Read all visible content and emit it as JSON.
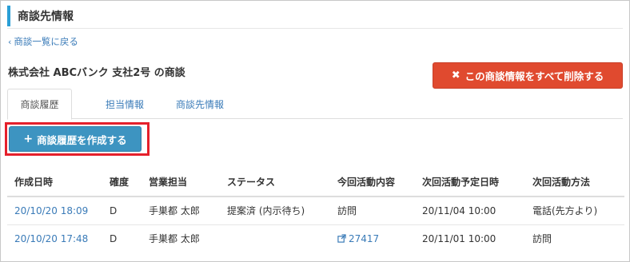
{
  "header": {
    "title": "商談先情報"
  },
  "nav": {
    "back_label": "商談一覧に戻る",
    "back_icon": "chevron-left-icon"
  },
  "deal": {
    "title": "株式会社 ABCバンク 支社2号 の商談"
  },
  "actions": {
    "delete_label": "この商談情報をすべて削除する",
    "create_label": "商談履歴を作成する"
  },
  "colors": {
    "accent_bar": "#2a9fd6",
    "delete": "#e04a2f",
    "create": "#3d94c1",
    "link": "#3a7bb8",
    "highlight": "#e5202b"
  },
  "tabs": [
    {
      "label": "商談履歴",
      "active": true
    },
    {
      "label": "担当情報",
      "active": false
    },
    {
      "label": "商談先情報",
      "active": false
    }
  ],
  "table": {
    "columns": [
      "作成日時",
      "確度",
      "営業担当",
      "ステータス",
      "今回活動内容",
      "次回活動予定日時",
      "次回活動方法"
    ],
    "rows": [
      {
        "created": "20/10/20 18:09",
        "probability": "D",
        "sales_rep": "手巣都 太郎",
        "status": "提案済 (内示待ち)",
        "activity": "訪問",
        "next_date": "20/11/04 10:00",
        "next_method": "電話(先方より)"
      },
      {
        "created": "20/10/20 17:48",
        "probability": "D",
        "sales_rep": "手巣都 太郎",
        "status": "",
        "activity": "27417",
        "next_date": "20/11/01 10:00",
        "next_method": "訪問"
      }
    ]
  }
}
